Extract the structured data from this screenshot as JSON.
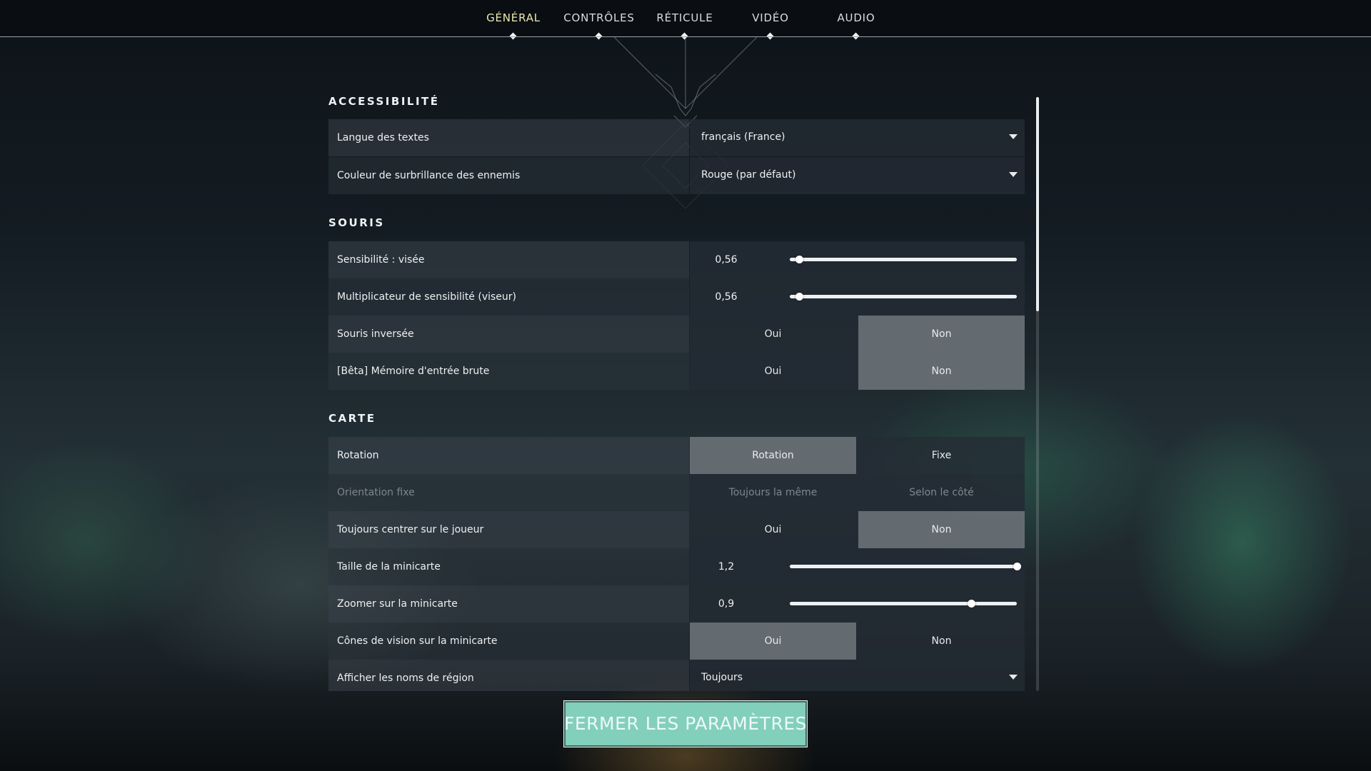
{
  "nav": {
    "tabs": [
      {
        "label": "GÉNÉRAL",
        "active": true
      },
      {
        "label": "CONTRÔLES",
        "active": false
      },
      {
        "label": "RÉTICULE",
        "active": false
      },
      {
        "label": "VIDÉO",
        "active": false
      },
      {
        "label": "AUDIO",
        "active": false
      }
    ]
  },
  "accessibility": {
    "title": "ACCESSIBILITÉ",
    "text_language": {
      "label": "Langue des textes",
      "value": "français (France)"
    },
    "enemy_highlight": {
      "label": "Couleur de surbrillance des ennemis",
      "value": "Rouge (par défaut)"
    }
  },
  "mouse": {
    "title": "SOURIS",
    "sensitivity": {
      "label": "Sensibilité : visée",
      "value": "0,56",
      "fraction": 0.04
    },
    "scoped_multiplier": {
      "label": "Multiplicateur de sensibilité (viseur)",
      "value": "0,56",
      "fraction": 0.04
    },
    "invert": {
      "label": "Souris inversée",
      "options": [
        "Oui",
        "Non"
      ],
      "selected": "Non"
    },
    "raw_input": {
      "label": "[Bêta] Mémoire d'entrée brute",
      "options": [
        "Oui",
        "Non"
      ],
      "selected": "Non"
    }
  },
  "map": {
    "title": "CARTE",
    "rotation": {
      "label": "Rotation",
      "options": [
        "Rotation",
        "Fixe"
      ],
      "selected": "Rotation"
    },
    "fixed_orientation": {
      "label": "Orientation fixe",
      "options": [
        "Toujours la même",
        "Selon le côté"
      ],
      "selected": "",
      "disabled": true
    },
    "center_player": {
      "label": "Toujours centrer sur le joueur",
      "options": [
        "Oui",
        "Non"
      ],
      "selected": "Non"
    },
    "minimap_size": {
      "label": "Taille de la minicarte",
      "value": "1,2",
      "fraction": 1.0
    },
    "minimap_zoom": {
      "label": "Zoomer sur la minicarte",
      "value": "0,9",
      "fraction": 0.8
    },
    "vision_cones": {
      "label": "Cônes de vision sur la minicarte",
      "options": [
        "Oui",
        "Non"
      ],
      "selected": "Oui"
    },
    "region_names": {
      "label": "Afficher les noms de région",
      "value": "Toujours"
    }
  },
  "close_button": "FERMER LES PARAMÈTRES",
  "colors": {
    "accent": "#82cfbc",
    "active_tab": "#ece8b0",
    "selected_option": "#7a8086"
  }
}
